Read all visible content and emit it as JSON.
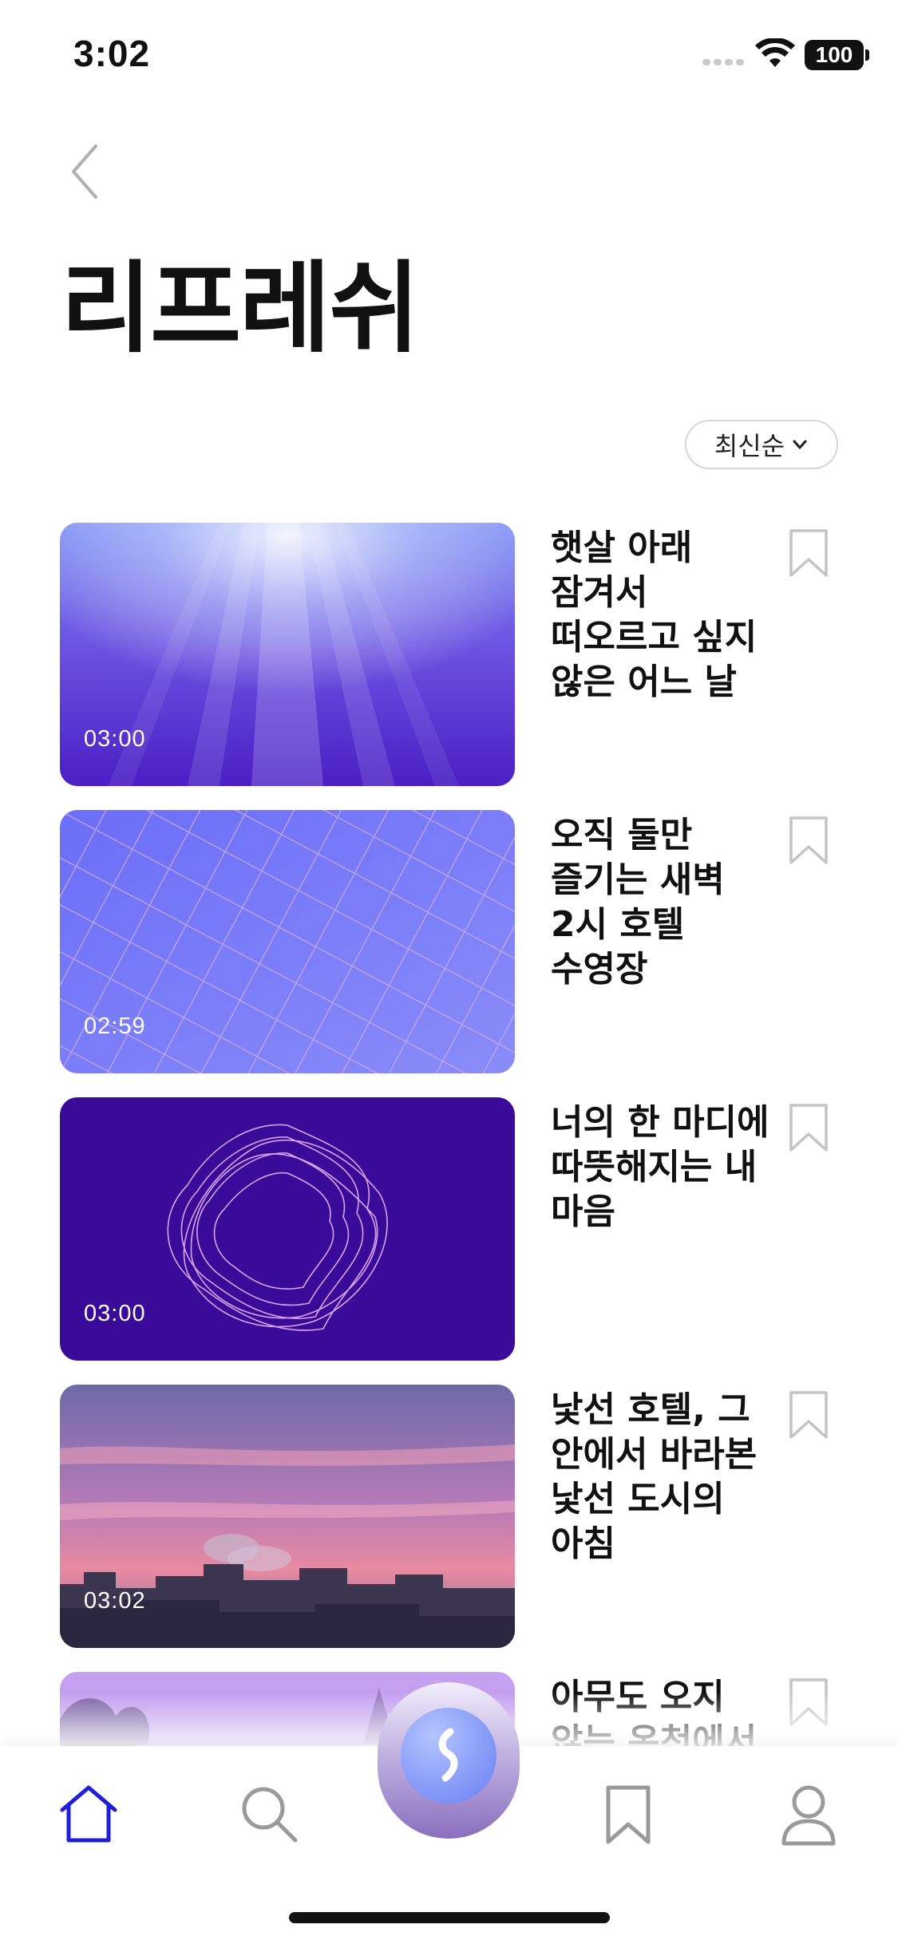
{
  "status_bar": {
    "time": "3:02",
    "battery": "100"
  },
  "header": {
    "back_icon": "chevron-left-icon",
    "title": "리프레쉬"
  },
  "sort": {
    "label": "최신순"
  },
  "items": [
    {
      "title": "햇살 아래 잠겨서 떠오르고 싶지 않은 어느 날",
      "duration": "03:00"
    },
    {
      "title": "오직 둘만 즐기는 새벽 2시 호텔 수영장",
      "duration": "02:59"
    },
    {
      "title": "너의 한 마디에 따뜻해지는 내 마음",
      "duration": "03:00"
    },
    {
      "title": "낯선 호텔, 그 안에서 바라본 낯선 도시의 아침",
      "duration": "03:02"
    },
    {
      "title": "아무도 오지 않는 온천에서",
      "duration": ""
    }
  ],
  "tab_bar": {
    "tabs": [
      "home-icon",
      "search-icon",
      "center-play-icon",
      "bookmark-icon",
      "profile-icon"
    ],
    "active": "home",
    "active_color": "#1f1fd6"
  }
}
